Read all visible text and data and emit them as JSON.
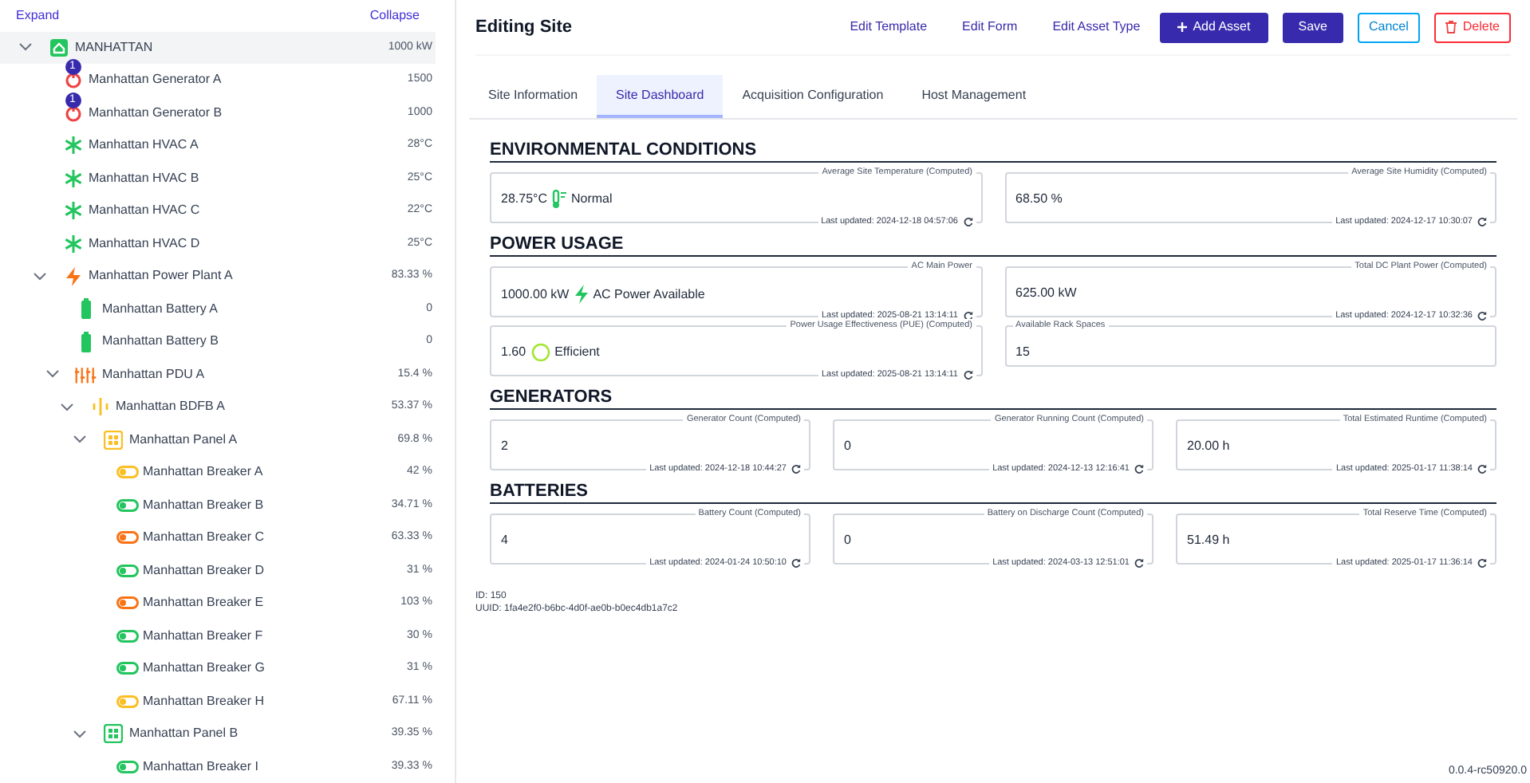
{
  "tree_toolbar": {
    "expand": "Expand",
    "collapse": "Collapse"
  },
  "tree": [
    {
      "kind": "site",
      "label": "MANHATTAN",
      "value": "1000 kW",
      "selected": true,
      "expanded": true,
      "children": [
        {
          "kind": "generator",
          "label": "Manhattan Generator A",
          "value": "1500",
          "badge": "1",
          "selected": false
        },
        {
          "kind": "generator",
          "label": "Manhattan Generator B",
          "value": "1000",
          "badge": "1",
          "selected": false
        },
        {
          "kind": "hvac",
          "label": "Manhattan HVAC A",
          "value": "28°C",
          "selected": false
        },
        {
          "kind": "hvac",
          "label": "Manhattan HVAC B",
          "value": "25°C",
          "selected": false
        },
        {
          "kind": "hvac",
          "label": "Manhattan HVAC C",
          "value": "22°C",
          "selected": false
        },
        {
          "kind": "hvac",
          "label": "Manhattan HVAC D",
          "value": "25°C",
          "selected": false
        },
        {
          "kind": "power-plant",
          "label": "Manhattan Power Plant A",
          "value": "83.33 %",
          "selected": false,
          "expanded": true,
          "children": [
            {
              "kind": "battery",
              "label": "Manhattan Battery A",
              "value": "0",
              "selected": false
            },
            {
              "kind": "battery",
              "label": "Manhattan Battery B",
              "value": "0",
              "selected": false
            },
            {
              "kind": "pdu",
              "label": "Manhattan PDU A",
              "value": "15.4 %",
              "selected": false,
              "expanded": true,
              "children": [
                {
                  "kind": "bdfb",
                  "label": "Manhattan BDFB A",
                  "value": "53.37 %",
                  "selected": false,
                  "expanded": true,
                  "children": [
                    {
                      "kind": "panel",
                      "label": "Manhattan Panel A",
                      "value": "69.8 %",
                      "color": "#fbbf24",
                      "selected": false,
                      "expanded": true,
                      "children": [
                        {
                          "kind": "breaker",
                          "label": "Manhattan Breaker A",
                          "value": "42 %",
                          "color": "#fbbf24",
                          "selected": false
                        },
                        {
                          "kind": "breaker",
                          "label": "Manhattan Breaker B",
                          "value": "34.71 %",
                          "color": "#22c55e",
                          "selected": false
                        },
                        {
                          "kind": "breaker",
                          "label": "Manhattan Breaker C",
                          "value": "63.33 %",
                          "color": "#f97316",
                          "selected": false
                        },
                        {
                          "kind": "breaker",
                          "label": "Manhattan Breaker D",
                          "value": "31 %",
                          "color": "#22c55e",
                          "selected": false
                        },
                        {
                          "kind": "breaker",
                          "label": "Manhattan Breaker E",
                          "value": "103 %",
                          "color": "#f97316",
                          "selected": false
                        },
                        {
                          "kind": "breaker",
                          "label": "Manhattan Breaker F",
                          "value": "30 %",
                          "color": "#22c55e",
                          "selected": false
                        },
                        {
                          "kind": "breaker",
                          "label": "Manhattan Breaker G",
                          "value": "31 %",
                          "color": "#22c55e",
                          "selected": false
                        },
                        {
                          "kind": "breaker",
                          "label": "Manhattan Breaker H",
                          "value": "67.11 %",
                          "color": "#fbbf24",
                          "selected": false
                        }
                      ]
                    },
                    {
                      "kind": "panel",
                      "label": "Manhattan Panel B",
                      "value": "39.35 %",
                      "color": "#22c55e",
                      "selected": false,
                      "expanded": true,
                      "children": [
                        {
                          "kind": "breaker",
                          "label": "Manhattan Breaker I",
                          "value": "39.33 %",
                          "color": "#22c55e",
                          "selected": false
                        }
                      ]
                    }
                  ]
                }
              ]
            }
          ]
        }
      ]
    }
  ],
  "header": {
    "title": "Editing Site",
    "links": [
      "Edit Template",
      "Edit Form",
      "Edit Asset Type"
    ],
    "buttons": [
      {
        "kind": "add",
        "label": "Add Asset"
      },
      {
        "kind": "save",
        "label": "Save"
      },
      {
        "kind": "cancel",
        "label": "Cancel"
      },
      {
        "kind": "delete",
        "label": "Delete"
      }
    ]
  },
  "tabs": [
    {
      "label": "Site Information",
      "selected": false
    },
    {
      "label": "Site Dashboard",
      "selected": true
    },
    {
      "label": "Acquisition Configuration",
      "selected": false
    },
    {
      "label": "Host Management",
      "selected": false
    }
  ],
  "sections": [
    {
      "title": "ENVIRONMENTAL CONDITIONS",
      "cards": [
        {
          "label": "Average Site Temperature (Computed)",
          "value": "28.75°C",
          "status": {
            "kind": "thermometer",
            "text": "Normal",
            "color": "#22c55e"
          },
          "updated": "Last updated: 2024-12-18 04:57:06"
        },
        {
          "label": "Average Site Humidity (Computed)",
          "value": "68.50 %",
          "updated": "Last updated: 2024-12-17 10:30:07"
        }
      ]
    },
    {
      "title": "POWER USAGE",
      "cards": [
        {
          "label": "AC Main Power",
          "value": "1000.00 kW",
          "status": {
            "kind": "bolt",
            "text": "AC Power Available",
            "color": "#22c55e"
          },
          "updated": "Last updated: 2025-08-21 13:14:11"
        },
        {
          "label": "Total DC Plant Power (Computed)",
          "value": "625.00 kW",
          "updated": "Last updated: 2024-12-17 10:32:36"
        },
        {
          "label": "Power Usage Effectiveness (PUE) (Computed)",
          "value": "1.60",
          "status": {
            "kind": "circle",
            "text": "Efficient",
            "color": "#a3e635"
          },
          "updated": "Last updated: 2025-08-21 13:14:11"
        },
        {
          "label": "Available Rack Spaces",
          "value": "15"
        }
      ]
    },
    {
      "title": "GENERATORS",
      "cards": [
        {
          "label": "Generator Count (Computed)",
          "value": "2",
          "updated": "Last updated: 2024-12-18 10:44:27"
        },
        {
          "label": "Generator Running Count (Computed)",
          "value": "0",
          "updated": "Last updated: 2024-12-13 12:16:41"
        },
        {
          "label": "Total Estimated Runtime (Computed)",
          "value": "20.00 h",
          "updated": "Last updated: 2025-01-17 11:38:14"
        }
      ]
    },
    {
      "title": "BATTERIES",
      "cards": [
        {
          "label": "Battery Count (Computed)",
          "value": "4",
          "updated": "Last updated: 2024-01-24 10:50:10"
        },
        {
          "label": "Battery on Discharge Count (Computed)",
          "value": "0",
          "updated": "Last updated: 2024-03-13 12:51:01"
        },
        {
          "label": "Total Reserve Time (Computed)",
          "value": "51.49 h",
          "updated": "Last updated: 2025-01-17 11:36:14"
        }
      ]
    }
  ],
  "footer": {
    "id": "ID: 150",
    "uuid": "UUID: 1fa4e2f0-b6bc-4d0f-ae0b-b0ec4db1a7c2",
    "version": "0.0.4-rc50920.0"
  }
}
